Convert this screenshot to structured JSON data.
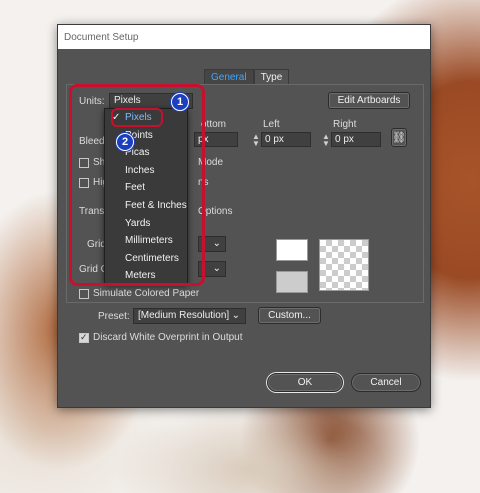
{
  "dialog": {
    "title": "Document Setup"
  },
  "tabs": [
    {
      "label": "General",
      "active": true
    },
    {
      "label": "Type",
      "active": false
    }
  ],
  "units": {
    "label": "Units:",
    "value": "Pixels"
  },
  "edit_artboards": "Edit Artboards",
  "bleed": {
    "label": "Bleed:",
    "bottom_label": "ottom",
    "bottom_value": "px",
    "left_label": "Left",
    "left_value": "0 px",
    "right_label": "Right",
    "right_value": "0 px"
  },
  "fragments": {
    "show": "Sho",
    "mode": "Mode",
    "high": "Hig",
    "ns": "ns",
    "transparency": "Transpa",
    "options": "Options",
    "grid": "Grid",
    "grid_colors": "Grid Co"
  },
  "dropdown": {
    "items": [
      "Pixels",
      "Points",
      "Picas",
      "Inches",
      "Feet",
      "Feet & Inches",
      "Yards",
      "Millimeters",
      "Centimeters",
      "Meters"
    ],
    "selected": "Pixels"
  },
  "simulate_colored_paper": {
    "label": "Simulate Colored Paper",
    "checked": false
  },
  "preset": {
    "label": "Preset:",
    "value": "[Medium Resolution]",
    "custom_button": "Custom..."
  },
  "discard_white": {
    "label": "Discard White Overprint in Output",
    "checked": true
  },
  "buttons": {
    "ok": "OK",
    "cancel": "Cancel"
  },
  "annotations": {
    "badge1": "1",
    "badge2": "2"
  },
  "colors": {
    "accent_blue": "#3fa6ff",
    "annotation_red": "#c8102e",
    "badge_blue": "#1c3fbf",
    "dialog_bg": "#535353"
  }
}
